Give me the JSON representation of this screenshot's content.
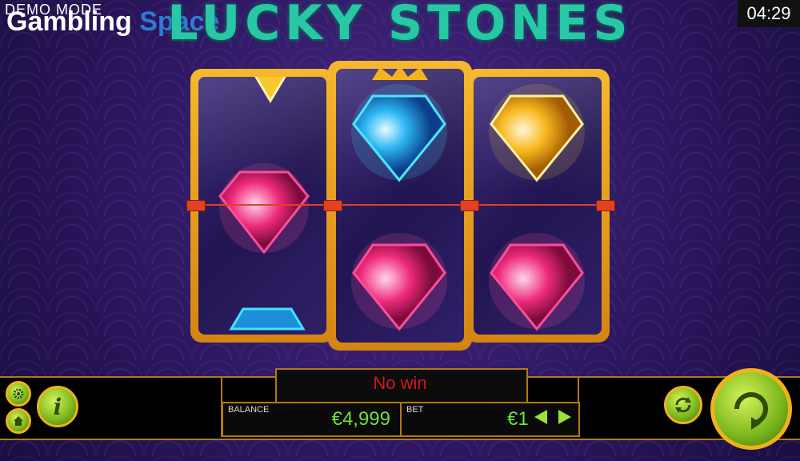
{
  "header": {
    "demo_mode": "DEMO MODE",
    "brand_part1": "Gambling",
    "brand_part2": "Space",
    "game_title": "LUCKY STONES",
    "clock": "04:29"
  },
  "status": {
    "message": "No win"
  },
  "balance": {
    "label": "BALANCE",
    "value": "€4,999"
  },
  "bet": {
    "label": "BET",
    "value": "€1"
  },
  "reels": [
    {
      "symbols": [
        "yellow-diamond",
        "pink-gem",
        "blue-diamond"
      ]
    },
    {
      "symbols": [
        "blue-diamond",
        "pink-gem"
      ]
    },
    {
      "symbols": [
        "yellow-diamond",
        "pink-gem"
      ]
    }
  ],
  "colors": {
    "title": "#28c7a6",
    "reel_frame": "#f6b82c",
    "status": "#d6151c",
    "value": "#6ee23a",
    "button": "#79b51b"
  },
  "icons": {
    "settings": "gear-icon",
    "home": "home-icon",
    "info": "info-icon",
    "autoplay": "autoplay-icon",
    "spin": "spin-icon"
  }
}
